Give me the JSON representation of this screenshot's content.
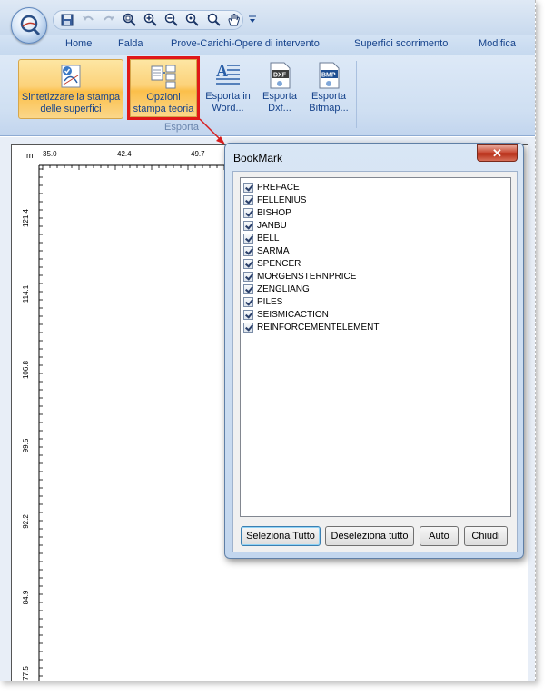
{
  "tabs": [
    {
      "label": "Home"
    },
    {
      "label": "Falda"
    },
    {
      "label": "Prove-Carichi-Opere di intervento"
    },
    {
      "label": "Superfici scorrimento"
    },
    {
      "label": "Modifica"
    }
  ],
  "ribbon": {
    "sintetizzare": {
      "line1": "Sintetizzare la stampa",
      "line2": "delle superfici"
    },
    "opzioni": {
      "line1": "Opzioni",
      "line2": "stampa teoria"
    },
    "word": {
      "line1": "Esporta in",
      "line2": "Word..."
    },
    "dxf": {
      "line1": "Esporta",
      "line2": "Dxf..."
    },
    "bmp": {
      "line1": "Esporta",
      "line2": "Bitmap..."
    },
    "group_label": "Esporta",
    "dxf_icon_text": "DXF",
    "bmp_icon_text": "BMP"
  },
  "canvas": {
    "unit": "m",
    "x_ticks": [
      "35.0",
      "42.4",
      "49.7"
    ],
    "y_ticks": [
      "121.4",
      "114.1",
      "106.8",
      "99.5",
      "92.2",
      "84.9",
      "77.5"
    ]
  },
  "dialog": {
    "title": "BookMark",
    "close_glyph": "✕",
    "items": [
      {
        "label": "PREFACE"
      },
      {
        "label": "FELLENIUS"
      },
      {
        "label": "BISHOP"
      },
      {
        "label": "JANBU"
      },
      {
        "label": "BELL"
      },
      {
        "label": "SARMA"
      },
      {
        "label": "SPENCER"
      },
      {
        "label": "MORGENSTERNPRICE"
      },
      {
        "label": "ZENGLIANG"
      },
      {
        "label": "PILES"
      },
      {
        "label": "SEISMICACTION"
      },
      {
        "label": "REINFORCEMENTELEMENT"
      }
    ],
    "buttons": {
      "select_all": "Seleziona Tutto",
      "deselect_all": "Deseleziona tutto",
      "auto": "Auto",
      "close": "Chiudi"
    }
  },
  "colors": {
    "highlight_border": "#e01818",
    "ribbon_text": "#15428b",
    "active_button": "#fbbf4a"
  }
}
